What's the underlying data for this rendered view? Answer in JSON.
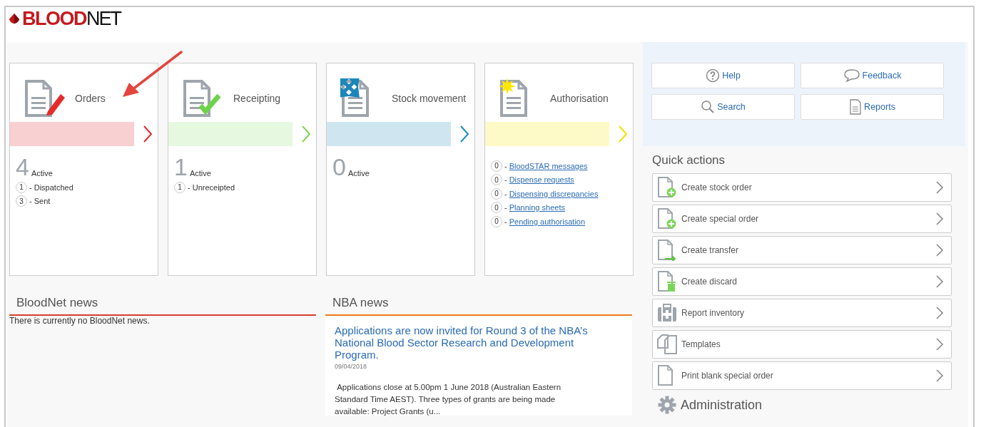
{
  "logo": {
    "strong": "BLOOD",
    "light": "NET"
  },
  "tiles": [
    {
      "kind": "summary",
      "title": "Orders",
      "color": "#f8d0d1",
      "chevron": {
        "color": "#e52b2b"
      },
      "count": "4",
      "count_label": "Active",
      "items": [
        {
          "count": "1",
          "label": "- Dispatched"
        },
        {
          "count": "3",
          "label": "- Sent"
        }
      ]
    },
    {
      "kind": "summary",
      "title": "Receipting",
      "color": "#e6f8e0",
      "chevron": {
        "color": "#7ed957"
      },
      "count": "1",
      "count_label": "Active",
      "items": [
        {
          "count": "1",
          "label": "- Unreceipted"
        }
      ]
    },
    {
      "kind": "summary",
      "title": "Stock movement",
      "color": "#cfe6f1",
      "chevron": {
        "color": "#1f8bc0"
      },
      "count": "0",
      "count_label": "Active"
    },
    {
      "kind": "links",
      "title": "Authorisation",
      "color": "#fefac8",
      "chevron": {
        "color": "#f5e000"
      },
      "items": [
        {
          "count": "0",
          "separator": "-",
          "label": "BloodSTAR messages"
        },
        {
          "count": "0",
          "separator": "-",
          "label": "Dispense requests"
        },
        {
          "count": "0",
          "separator": "-",
          "label": "Dispensing discrepancies"
        },
        {
          "count": "0",
          "separator": "-",
          "label": "Planning sheets"
        },
        {
          "count": "0",
          "separator": "-",
          "label": "Pending authorisation"
        }
      ]
    }
  ],
  "tools": [
    "Help",
    "Feedback",
    "Search",
    "Reports"
  ],
  "quick_actions": {
    "title": "Quick actions",
    "items": [
      "Create stock order",
      "Create special order",
      "Create transfer",
      "Create discard",
      "Report inventory",
      "Templates",
      "Print blank special order"
    ]
  },
  "administration": {
    "title": "Administration"
  },
  "bloodnet_news": {
    "title": "BloodNet news",
    "text": "There is currently no BloodNet news."
  },
  "nba_news": {
    "title": "NBA news",
    "headline": "Applications are now invited for Round 3 of the NBA’s National Blood Sector Research and Development Program.",
    "date": "09/04/2018",
    "text": " Applications close at 5.00pm 1 June 2018 (Australian Eastern Standard Time AEST). Three types of grants are being made available: Project Grants (u..."
  }
}
